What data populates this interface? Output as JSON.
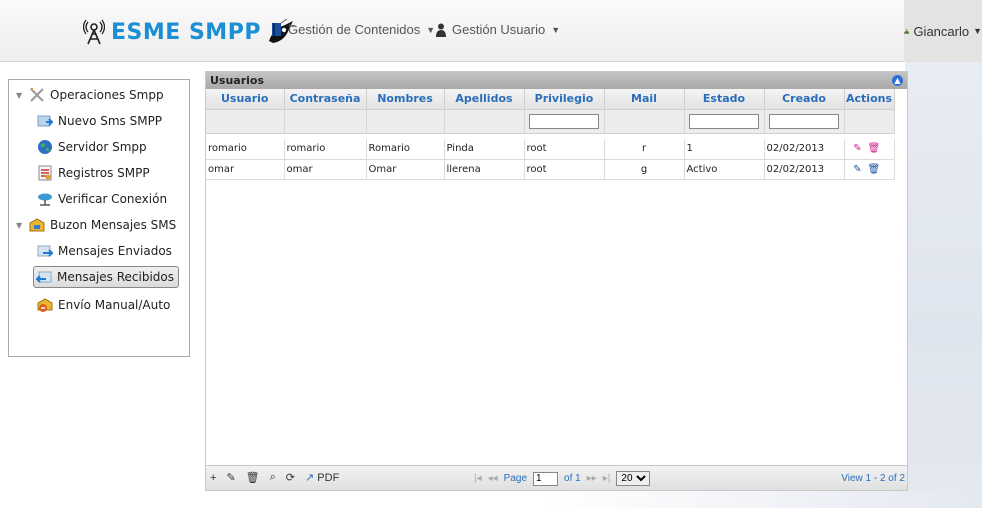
{
  "navbar": {
    "brand": "ESME SMPP",
    "menu1": "Gestión de Contenidos",
    "menu2": "Gestión Usuario",
    "user": "Giancarlo"
  },
  "sidebar": {
    "items": [
      {
        "label": "Operaciones Smpp",
        "icon": "tools-icon"
      },
      {
        "label": "Nuevo Sms SMPP",
        "icon": "new-sms-icon"
      },
      {
        "label": "Servidor Smpp",
        "icon": "globe-icon"
      },
      {
        "label": "Registros SMPP",
        "icon": "registry-icon"
      },
      {
        "label": "Verificar Conexión",
        "icon": "network-icon"
      },
      {
        "label": "Buzon Mensajes SMS",
        "icon": "mailbox-icon"
      },
      {
        "label": "Mensajes Enviados",
        "icon": "sent-icon"
      },
      {
        "label": "Mensajes Recibidos",
        "icon": "received-icon"
      },
      {
        "label": "Envío Manual/Auto",
        "icon": "auto-send-icon"
      }
    ],
    "selected": "Mensajes Recibidos"
  },
  "grid": {
    "caption": "Usuarios",
    "columns": [
      "Usuario",
      "Contraseña",
      "Nombres",
      "Apellidos",
      "Privilegio",
      "Mail",
      "Estado",
      "Creado",
      "Actions"
    ],
    "rows": [
      [
        "romario",
        "romario",
        "Romario",
        "Pinda",
        "root",
        "r",
        "1",
        "02/02/2013"
      ],
      [
        "omar",
        "omar",
        "Omar",
        "llerena",
        "root",
        "g",
        "Activo",
        "02/02/2013"
      ]
    ]
  },
  "pager": {
    "pdf_label": "PDF",
    "page_label": "Page",
    "page_value": "1",
    "of_label": "of 1",
    "rows_per_page": "20",
    "view_text": "View 1 - 2 of 2"
  }
}
